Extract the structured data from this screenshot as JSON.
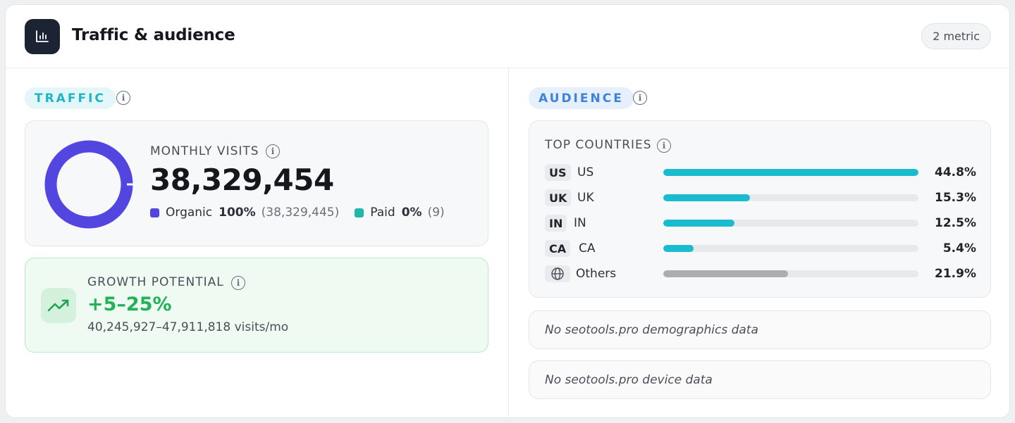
{
  "header": {
    "title": "Traffic & audience",
    "icon": "bar-chart-icon",
    "badge": "2 metric"
  },
  "traffic": {
    "section_label": "TRAFFIC",
    "monthly_visits": {
      "label": "MONTHLY VISITS",
      "value": "38,329,454",
      "organic": {
        "label": "Organic",
        "percent": "100%",
        "count": "(38,329,445)",
        "color": "#5346e0",
        "fraction": 1.0
      },
      "paid": {
        "label": "Paid",
        "percent": "0%",
        "count": "(9)",
        "color": "#1fb8a8"
      }
    },
    "growth": {
      "label": "GROWTH POTENTIAL",
      "value": "+5–25%",
      "range": "40,245,927–47,911,818 visits/mo",
      "icon": "trending-up-icon",
      "color": "#22b25a"
    }
  },
  "audience": {
    "section_label": "AUDIENCE",
    "top_countries": {
      "label": "TOP COUNTRIES",
      "rows": [
        {
          "code": "US",
          "name": "US",
          "percent": "44.8%",
          "share": 1.0,
          "color": "#19bccf"
        },
        {
          "code": "UK",
          "name": "UK",
          "percent": "15.3%",
          "share": 0.34,
          "color": "#19bccf"
        },
        {
          "code": "IN",
          "name": "IN",
          "percent": "12.5%",
          "share": 0.28,
          "color": "#19bccf"
        },
        {
          "code": "CA",
          "name": "CA",
          "percent": "5.4%",
          "share": 0.12,
          "color": "#19bccf"
        },
        {
          "code": "",
          "name": "Others",
          "percent": "21.9%",
          "share": 0.49,
          "color": "#adadb0",
          "icon": "globe-icon"
        }
      ]
    },
    "demographics_note": "No seotools.pro demographics data",
    "device_note": "No seotools.pro device data"
  }
}
